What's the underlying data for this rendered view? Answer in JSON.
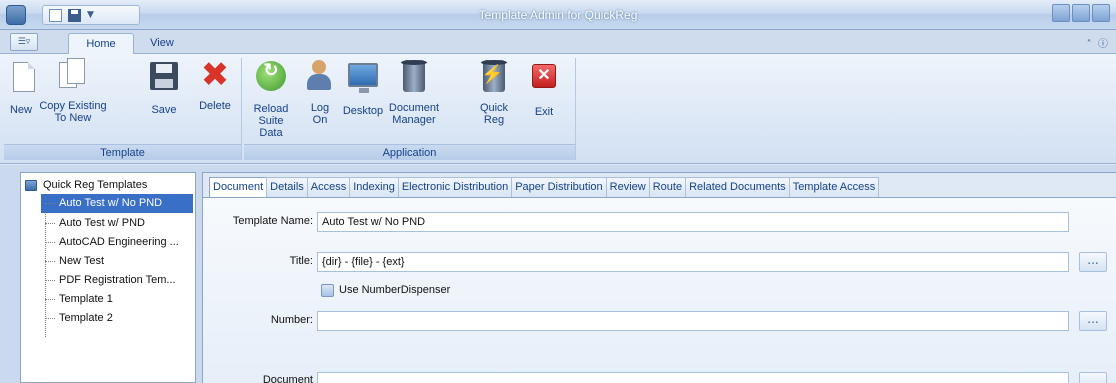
{
  "window": {
    "title": "Template Admin for QuickReg"
  },
  "ribbon_tabs": [
    {
      "label": "Home",
      "active": true
    },
    {
      "label": "View",
      "active": false
    }
  ],
  "ribbon": {
    "groups": [
      {
        "label": "Template",
        "buttons": [
          {
            "label": "New",
            "icon": "new-document-icon"
          },
          {
            "label": "Copy Existing\nTo New",
            "icon": "copy-document-icon"
          },
          {
            "label": "Save",
            "icon": "floppy-disk-icon"
          },
          {
            "label": "Delete",
            "icon": "red-x-icon"
          }
        ]
      },
      {
        "label": "Application",
        "buttons": [
          {
            "label": "Reload\nSuite Data",
            "icon": "reload-icon"
          },
          {
            "label": "Log On",
            "icon": "user-key-icon"
          },
          {
            "label": "Desktop",
            "icon": "monitor-icon"
          },
          {
            "label": "Document\nManager",
            "icon": "document-manager-icon"
          },
          {
            "label": "Quick\nReg",
            "icon": "quick-reg-icon"
          },
          {
            "label": "Exit",
            "icon": "exit-icon"
          }
        ]
      }
    ]
  },
  "tree": {
    "root": "Quick Reg Templates",
    "items": [
      {
        "label": "Auto Test w/ No PND",
        "selected": true
      },
      {
        "label": "Auto Test w/ PND",
        "selected": false
      },
      {
        "label": "AutoCAD Engineering ...",
        "selected": false
      },
      {
        "label": "New Test",
        "selected": false
      },
      {
        "label": "PDF Registration Tem...",
        "selected": false
      },
      {
        "label": "Template 1",
        "selected": false
      },
      {
        "label": "Template 2",
        "selected": false
      }
    ]
  },
  "doc_tabs": [
    {
      "label": "Document",
      "active": true
    },
    {
      "label": "Details",
      "active": false
    },
    {
      "label": "Access",
      "active": false
    },
    {
      "label": "Indexing",
      "active": false
    },
    {
      "label": "Electronic Distribution",
      "active": false
    },
    {
      "label": "Paper Distribution",
      "active": false
    },
    {
      "label": "Review",
      "active": false
    },
    {
      "label": "Route",
      "active": false
    },
    {
      "label": "Related Documents",
      "active": false
    },
    {
      "label": "Template Access",
      "active": false
    }
  ],
  "form": {
    "template_name_label": "Template Name:",
    "template_name_value": "Auto Test w/ No PND",
    "title_label": "Title:",
    "title_value": "{dir} - {file} - {ext}",
    "use_dispenser_label": "Use NumberDispenser",
    "number_label": "Number:",
    "number_value": "",
    "document_label": "Document",
    "ellipsis": "..."
  },
  "colors": {
    "title_bar": "#c9daf0",
    "selected_item": "#3a6fc7",
    "delete_red": "#d9332a",
    "text_blue": "#15428b"
  }
}
